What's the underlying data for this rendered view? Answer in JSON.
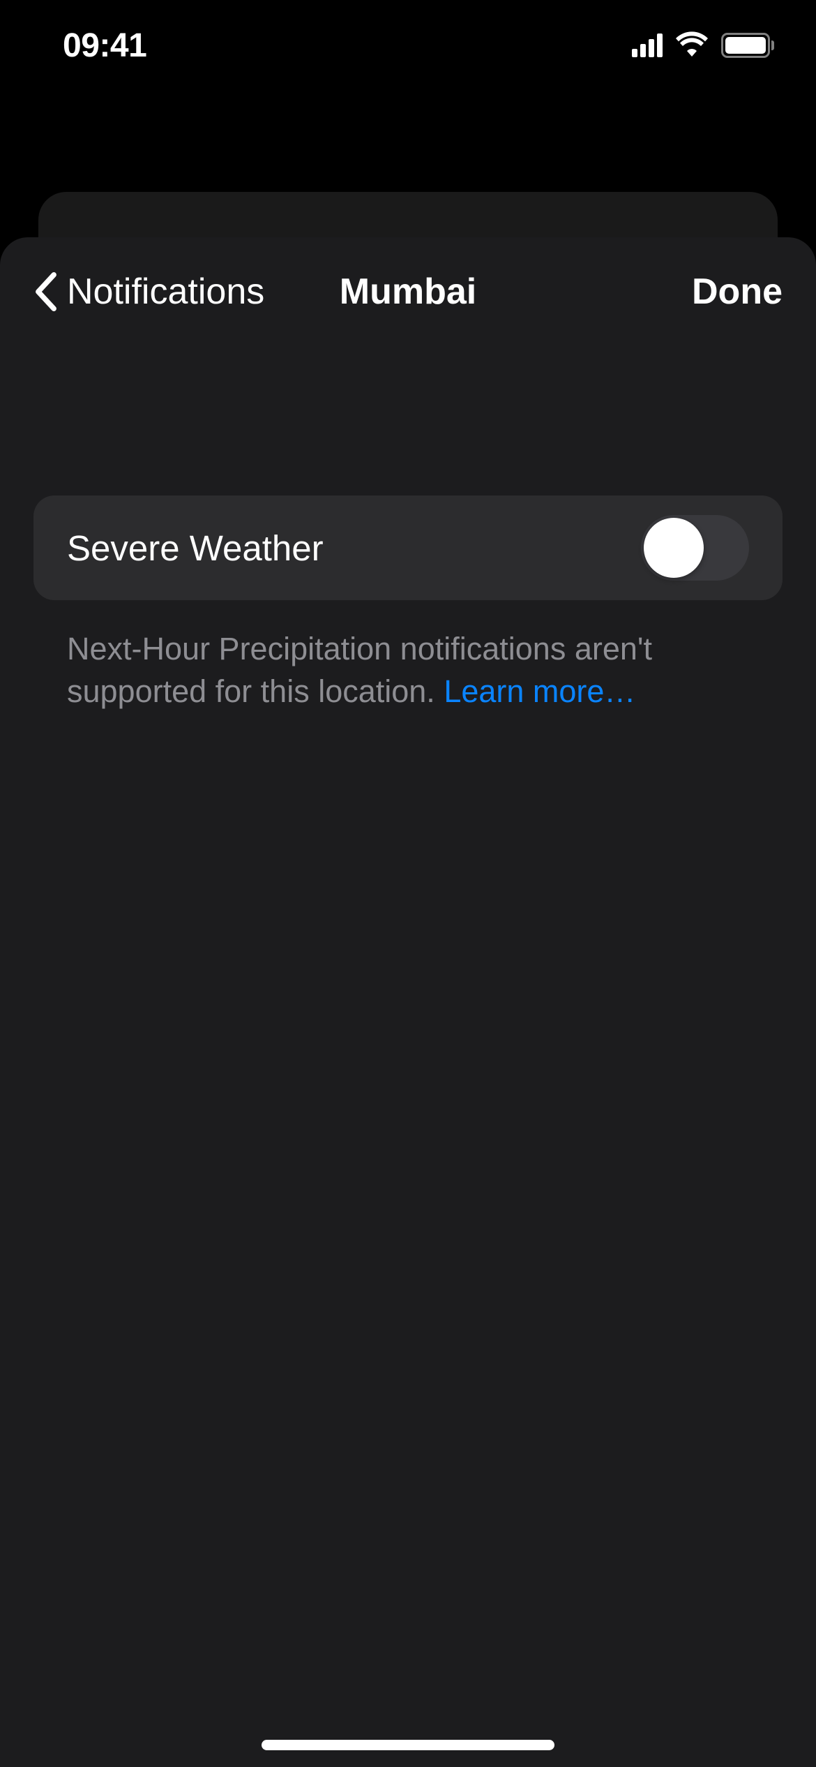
{
  "statusBar": {
    "time": "09:41"
  },
  "nav": {
    "backLabel": "Notifications",
    "title": "Mumbai",
    "done": "Done"
  },
  "settings": {
    "severeWeather": {
      "label": "Severe Weather",
      "enabled": false
    }
  },
  "footer": {
    "text": "Next-Hour Precipitation notifications aren't supported for this location. ",
    "linkText": "Learn more…"
  }
}
